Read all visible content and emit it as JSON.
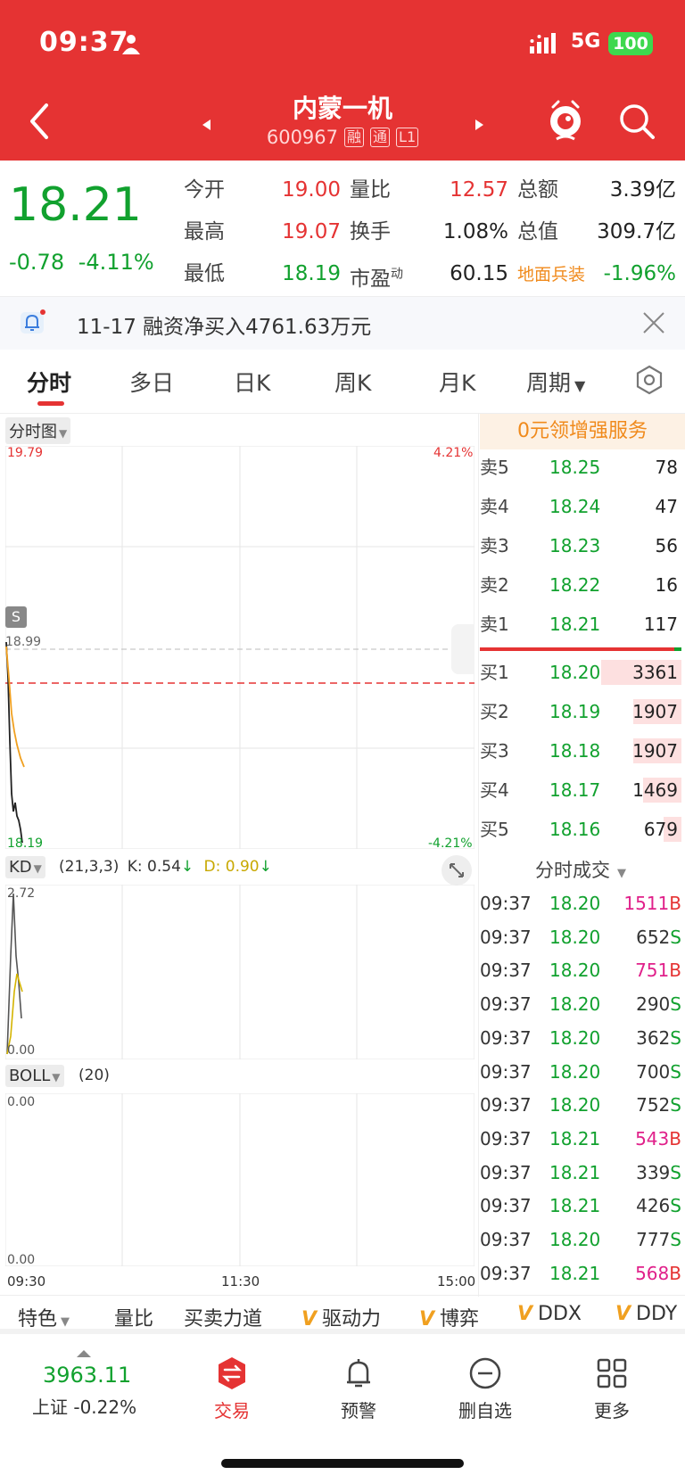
{
  "status_bar": {
    "time": "09:37",
    "network": "5G",
    "battery": "100"
  },
  "header": {
    "stock_name": "内蒙一机",
    "stock_code": "600967",
    "tags": [
      "融",
      "通",
      "L1"
    ]
  },
  "quote": {
    "price": "18.21",
    "change": "-0.78",
    "change_pct": "-4.11%",
    "fields": [
      {
        "label": "今开",
        "value": "19.00"
      },
      {
        "label": "量比",
        "value": "12.57"
      },
      {
        "label": "总额",
        "value": "3.39亿"
      },
      {
        "label": "最高",
        "value": "19.07"
      },
      {
        "label": "换手",
        "value": "1.08%"
      },
      {
        "label": "总值",
        "value": "309.7亿"
      },
      {
        "label": "最低",
        "value": "18.19"
      },
      {
        "label": "市盈",
        "sup": "动",
        "value": "60.15"
      },
      {
        "label": "地面兵装",
        "value": "-1.96%"
      }
    ]
  },
  "notice": {
    "text": "11-17 融资净买入4761.63万元"
  },
  "tabs": [
    "分时",
    "多日",
    "日K",
    "周K",
    "月K",
    "周期"
  ],
  "intraday": {
    "selector": "分时图",
    "y_top": "19.79",
    "pct_top": "4.21%",
    "y_bottom": "18.19",
    "pct_bottom": "-4.21%",
    "prev_close_label": "18.99",
    "s_marker": "S",
    "time_axis": [
      "09:30",
      "11:30",
      "15:00"
    ]
  },
  "kd": {
    "selector": "KD",
    "params": "(21,3,3)",
    "k": "K: 0.54",
    "d": "D: 0.90",
    "y_top": "2.72",
    "y_bottom": "0.00"
  },
  "boll": {
    "selector": "BOLL",
    "params": "(20)",
    "y_top": "0.00",
    "y_bottom": "0.00"
  },
  "order_book": {
    "promo": "0元领增强服务",
    "asks": [
      {
        "label": "卖5",
        "price": "18.25",
        "vol": "78"
      },
      {
        "label": "卖4",
        "price": "18.24",
        "vol": "47"
      },
      {
        "label": "卖3",
        "price": "18.23",
        "vol": "56"
      },
      {
        "label": "卖2",
        "price": "18.22",
        "vol": "16"
      },
      {
        "label": "卖1",
        "price": "18.21",
        "vol": "117"
      }
    ],
    "bids": [
      {
        "label": "买1",
        "price": "18.20",
        "vol": "3361",
        "fill": 0.4
      },
      {
        "label": "买2",
        "price": "18.19",
        "vol": "1907",
        "fill": 0.24
      },
      {
        "label": "买3",
        "price": "18.18",
        "vol": "1907",
        "fill": 0.24
      },
      {
        "label": "买4",
        "price": "18.17",
        "vol": "1469",
        "fill": 0.19
      },
      {
        "label": "买5",
        "price": "18.16",
        "vol": "679",
        "fill": 0.09
      }
    ]
  },
  "trades": {
    "header": "分时成交",
    "rows": [
      {
        "time": "09:37",
        "price": "18.20",
        "vol": "1511",
        "side": "B"
      },
      {
        "time": "09:37",
        "price": "18.20",
        "vol": "652",
        "side": "S"
      },
      {
        "time": "09:37",
        "price": "18.20",
        "vol": "751",
        "side": "B"
      },
      {
        "time": "09:37",
        "price": "18.20",
        "vol": "290",
        "side": "S"
      },
      {
        "time": "09:37",
        "price": "18.20",
        "vol": "362",
        "side": "S"
      },
      {
        "time": "09:37",
        "price": "18.20",
        "vol": "700",
        "side": "S"
      },
      {
        "time": "09:37",
        "price": "18.20",
        "vol": "752",
        "side": "S"
      },
      {
        "time": "09:37",
        "price": "18.21",
        "vol": "543",
        "side": "B"
      },
      {
        "time": "09:37",
        "price": "18.21",
        "vol": "339",
        "side": "S"
      },
      {
        "time": "09:37",
        "price": "18.21",
        "vol": "426",
        "side": "S"
      },
      {
        "time": "09:37",
        "price": "18.20",
        "vol": "777",
        "side": "S"
      },
      {
        "time": "09:37",
        "price": "18.21",
        "vol": "568",
        "side": "B"
      }
    ]
  },
  "indicators": [
    "特色",
    "量比",
    "买卖力道",
    "驱动力",
    "博弈",
    "DDX",
    "DDY"
  ],
  "bottom_nav": {
    "index_value": "3963.11",
    "index_label": "上证 -0.22%",
    "items": [
      "交易",
      "预警",
      "删自选",
      "更多"
    ]
  },
  "colors": {
    "red": "#e53333",
    "green": "#11a12e",
    "orange": "#f08a1c",
    "magenta": "#e0208a"
  }
}
